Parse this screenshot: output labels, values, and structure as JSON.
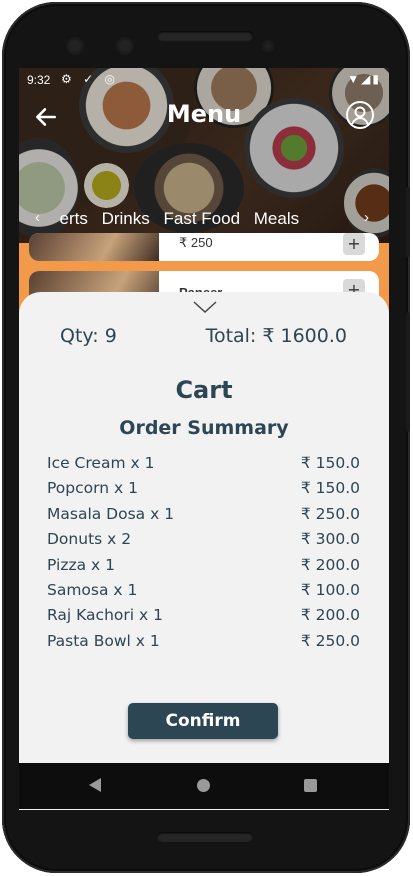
{
  "status": {
    "time": "9:32",
    "left_icons": "⚙ ✓ ◎",
    "right_icons": "▼◢▮"
  },
  "header": {
    "title": "Menu"
  },
  "categories": {
    "items": [
      "serts",
      "Drinks",
      "Fast Food",
      "Meals"
    ]
  },
  "menu_cards": [
    {
      "label": "₹ 250"
    },
    {
      "label": "Paneer"
    }
  ],
  "cart": {
    "qty_label": "Qty: 9",
    "total_label": "Total: ₹ 1600.0",
    "title": "Cart",
    "summary_title": "Order Summary",
    "items": [
      {
        "name": "Ice Cream x 1",
        "price": "₹ 150.0"
      },
      {
        "name": "Popcorn x 1",
        "price": "₹ 150.0"
      },
      {
        "name": "Masala Dosa x 1",
        "price": "₹ 250.0"
      },
      {
        "name": "Donuts x 2",
        "price": "₹ 300.0"
      },
      {
        "name": "Pizza x 1",
        "price": "₹ 200.0"
      },
      {
        "name": "Samosa x 1",
        "price": "₹ 100.0"
      },
      {
        "name": "Raj Kachori x 1",
        "price": "₹ 200.0"
      },
      {
        "name": "Pasta Bowl x 1",
        "price": "₹ 250.0"
      }
    ],
    "confirm_label": "Confirm"
  },
  "colors": {
    "accent": "#2d4654",
    "orange": "#f2994a",
    "sheet": "#f2f2f2"
  }
}
